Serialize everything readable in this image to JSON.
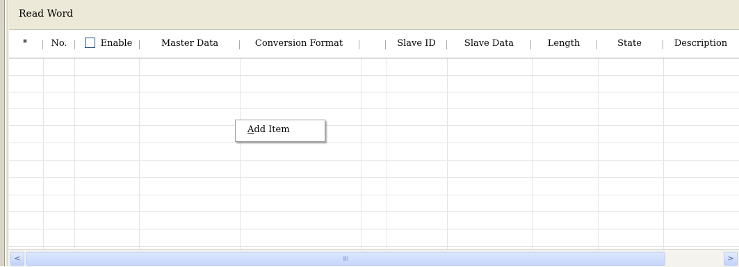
{
  "panel": {
    "title": "Read Word"
  },
  "columns": [
    {
      "key": "star",
      "label": "*"
    },
    {
      "key": "no",
      "label": "No."
    },
    {
      "key": "enable",
      "label": "Enable"
    },
    {
      "key": "master_data",
      "label": "Master Data"
    },
    {
      "key": "conversion_format",
      "label": "Conversion Format"
    },
    {
      "key": "slave_id",
      "label": "Slave ID"
    },
    {
      "key": "slave_data",
      "label": "Slave Data"
    },
    {
      "key": "length",
      "label": "Length"
    },
    {
      "key": "state",
      "label": "State"
    },
    {
      "key": "description",
      "label": "Description"
    }
  ],
  "enable_checkbox": {
    "checked": false
  },
  "context_menu": {
    "items": [
      {
        "accel": "A",
        "rest": "dd Item"
      }
    ]
  },
  "scrollbar": {
    "left_arrow": "<",
    "right_arrow": ">",
    "grip": "IIII"
  },
  "colors": {
    "title_bar": "#ece9d8",
    "grid_line": "#e4e4e4",
    "scroll_thumb": "#c6d7fc"
  }
}
